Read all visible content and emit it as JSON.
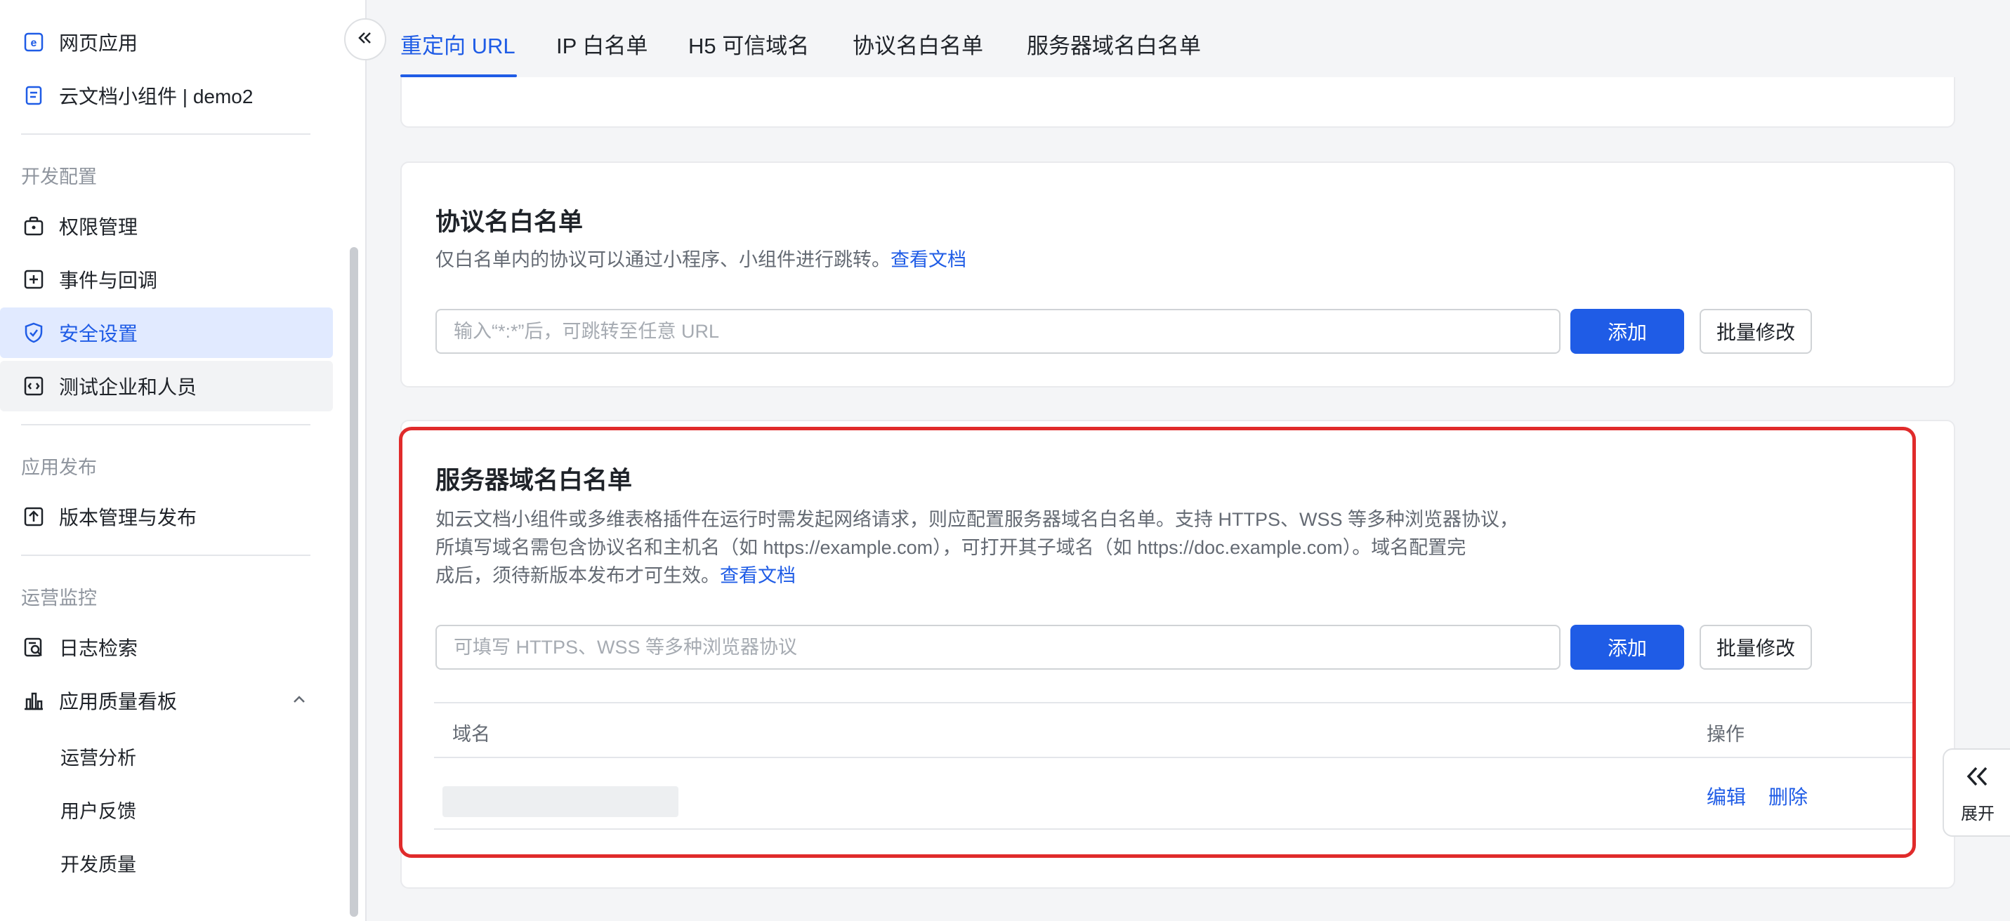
{
  "sidebar": {
    "items_top": [
      {
        "label": "网页应用",
        "icon": "web-app-icon"
      },
      {
        "label": "云文档小组件 | demo2",
        "icon": "doc-widget-icon"
      }
    ],
    "sections": [
      {
        "title": "开发配置"
      },
      {
        "title": "应用发布"
      },
      {
        "title": "运营监控"
      }
    ],
    "dev_items": [
      {
        "label": "权限管理",
        "icon": "permission-icon"
      },
      {
        "label": "事件与回调",
        "icon": "event-callback-icon"
      },
      {
        "label": "安全设置",
        "icon": "shield-icon",
        "active": true
      },
      {
        "label": "测试企业和人员",
        "icon": "test-enterprise-icon"
      }
    ],
    "release_items": [
      {
        "label": "版本管理与发布",
        "icon": "upload-icon"
      }
    ],
    "monitor_items": [
      {
        "label": "日志检索",
        "icon": "log-search-icon"
      },
      {
        "label": "应用质量看板",
        "icon": "bar-chart-icon",
        "expanded": true
      }
    ],
    "sub_items": [
      "运营分析",
      "用户反馈",
      "开发质量"
    ]
  },
  "tabs": [
    {
      "label": "重定向 URL",
      "active": true
    },
    {
      "label": "IP 白名单"
    },
    {
      "label": "H5 可信域名"
    },
    {
      "label": "协议名白名单"
    },
    {
      "label": "服务器域名白名单"
    }
  ],
  "protocol_card": {
    "title": "协议名白名单",
    "desc": "仅白名单内的协议可以通过小程序、小组件进行跳转。",
    "doc_link": "查看文档",
    "input_placeholder": "输入“*:*”后，可跳转至任意 URL",
    "add_label": "添加",
    "batch_label": "批量修改"
  },
  "server_card": {
    "title": "服务器域名白名单",
    "desc_line1": "如云文档小组件或多维表格插件在运行时需发起网络请求，则应配置服务器域名白名单。支持 HTTPS、WSS 等多种浏览器协议，",
    "desc_line2": "所填写域名需包含协议名和主机名（如 https://example.com），可打开其子域名（如 https://doc.example.com）。域名配置完",
    "desc_line3": "成后，须待新版本发布才可生效。",
    "doc_link": "查看文档",
    "input_placeholder": "可填写 HTTPS、WSS 等多种浏览器协议",
    "add_label": "添加",
    "batch_label": "批量修改",
    "table": {
      "col_domain": "域名",
      "col_action": "操作",
      "rows": [
        {
          "domain": "",
          "edit": "编辑",
          "delete": "删除"
        }
      ]
    }
  },
  "expand_button": {
    "label": "展开"
  },
  "colors": {
    "accent": "#1f5ce6",
    "highlight": "#e02b2b",
    "active_bg": "#e1eaff"
  }
}
